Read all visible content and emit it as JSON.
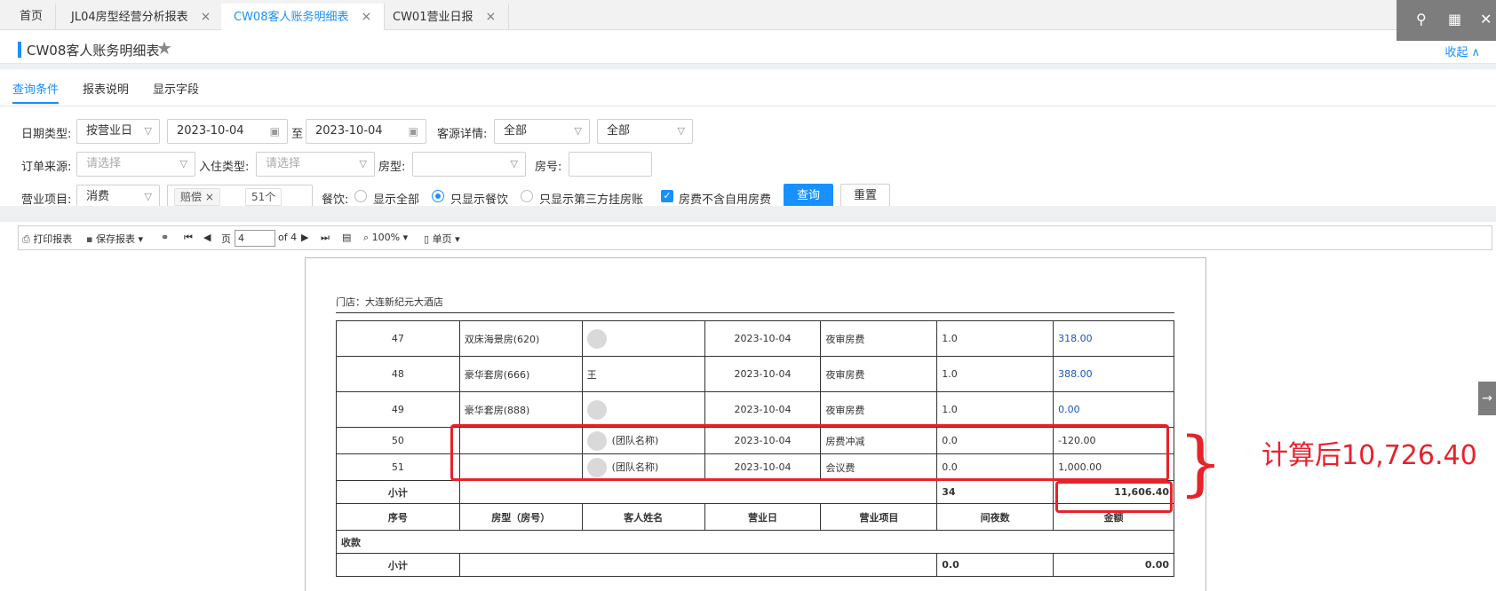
{
  "tabs": [
    {
      "label": "首页",
      "closable": false,
      "active": false
    },
    {
      "label": "JL04房型经营分析报表",
      "closable": true,
      "active": false
    },
    {
      "label": "CW08客人账务明细表",
      "closable": true,
      "active": true
    },
    {
      "label": "CW01营业日报",
      "closable": true,
      "active": false
    }
  ],
  "title": {
    "text": "CW08客人账务明细表",
    "collapse": "收起 ∧"
  },
  "subtabs": [
    "查询条件",
    "报表说明",
    "显示字段"
  ],
  "form": {
    "date_type_label": "日期类型:",
    "date_type_value": "按营业日",
    "date_from": "2023-10-04",
    "date_sep": "至",
    "date_to": "2023-10-04",
    "source_detail_label": "客源详情:",
    "source_detail_value1": "全部",
    "source_detail_value2": "全部",
    "order_source_label": "订单来源:",
    "order_source_placeholder": "请选择",
    "checkin_type_label": "入住类型:",
    "checkin_type_placeholder": "请选择",
    "room_type_label": "房型:",
    "room_no_label": "房号:",
    "biz_item_label": "营业项目:",
    "biz_item_value": "消费",
    "tag_text": "赔偿",
    "tag_count": "51个",
    "dining_label": "餐饮:",
    "radio_all": "显示全部",
    "radio_dining": "只显示餐饮",
    "radio_third": "只显示第三方挂房账",
    "checkbox_label": "房费不含自用房费",
    "query_btn": "查询",
    "reset_btn": "重置"
  },
  "toolbar": {
    "print": "打印报表",
    "save": "保存报表",
    "page_label": "页",
    "page_value": "4",
    "page_of": "of 4",
    "zoom": "100%",
    "view": "单页"
  },
  "report": {
    "store": "门店：大连新纪元大酒店",
    "rows": [
      {
        "no": "47",
        "room": "双床海景房(620)",
        "guest": "",
        "day": "2023-10-04",
        "item": "夜审房费",
        "nights": "1.0",
        "amount": "318.00",
        "blue": true
      },
      {
        "no": "48",
        "room": "豪华套房(666)",
        "guest": "王",
        "day": "2023-10-04",
        "item": "夜审房费",
        "nights": "1.0",
        "amount": "388.00",
        "blue": true
      },
      {
        "no": "49",
        "room": "豪华套房(888)",
        "guest": "",
        "day": "2023-10-04",
        "item": "夜审房费",
        "nights": "1.0",
        "amount": "0.00",
        "blue": true
      },
      {
        "no": "50",
        "room": "",
        "guest": "(团队名称)",
        "day": "2023-10-04",
        "item": "房费冲减",
        "nights": "0.0",
        "amount": "-120.00",
        "blue": false
      },
      {
        "no": "51",
        "room": "",
        "guest": "(团队名称)",
        "day": "2023-10-04",
        "item": "会议费",
        "nights": "0.0",
        "amount": "1,000.00",
        "blue": false
      }
    ],
    "subtotal_label": "小计",
    "subtotal_nights": "34",
    "subtotal_amount": "11,606.40",
    "headers": [
      "序号",
      "房型（房号）",
      "客人姓名",
      "营业日",
      "营业项目",
      "间夜数",
      "金额"
    ],
    "payment_label": "收款",
    "payment_subtotal_label": "小计",
    "payment_nights": "0.0",
    "payment_amount": "0.00"
  },
  "annotation": {
    "note": "计算后10,726.40",
    "color": "#e8222a"
  }
}
